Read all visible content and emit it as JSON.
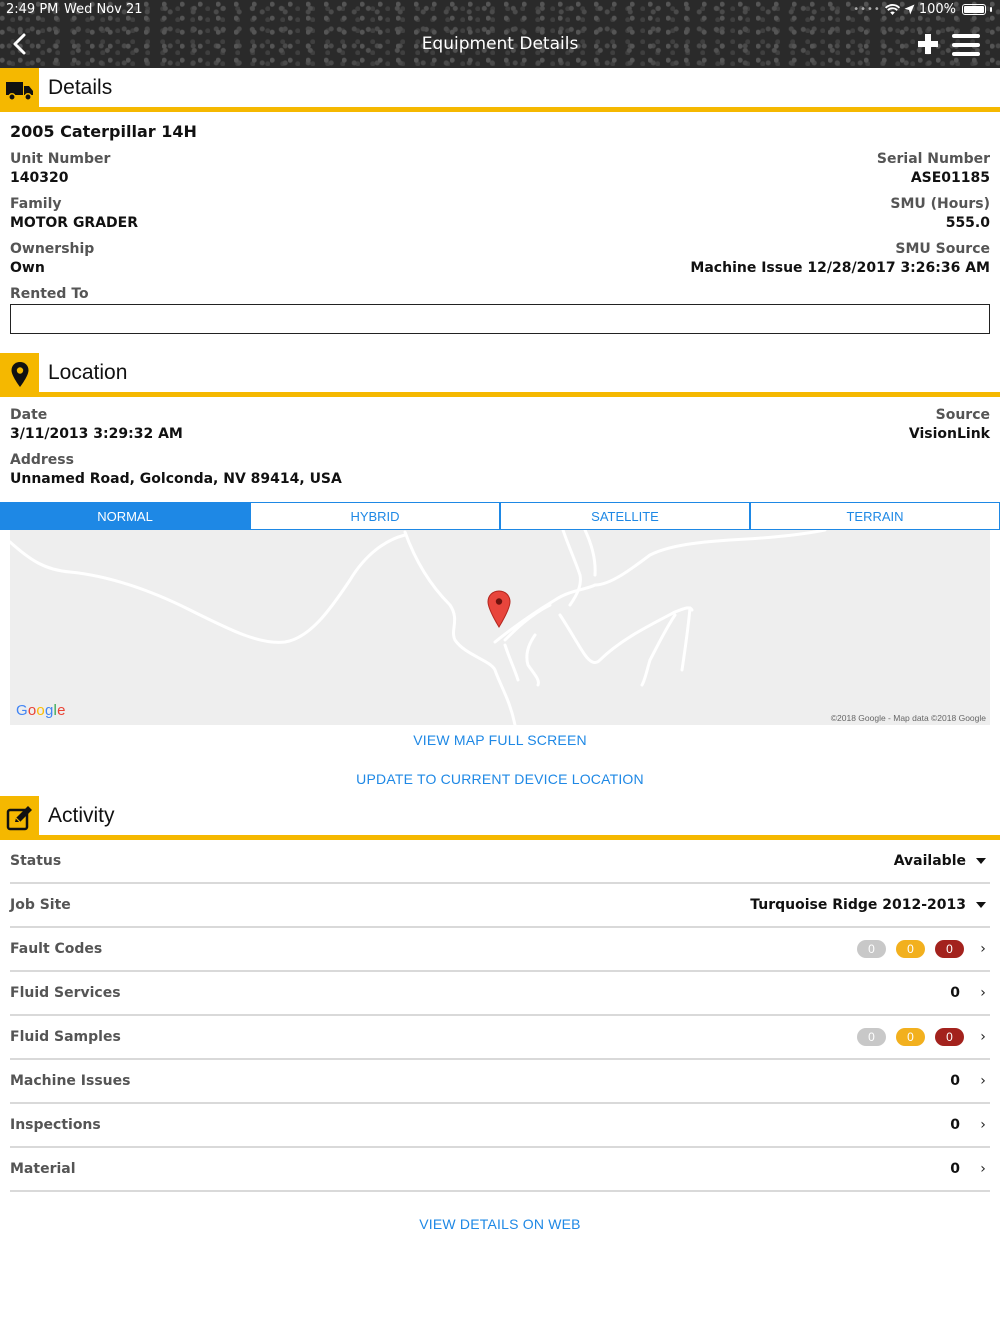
{
  "status_bar": {
    "time": "2:49 PM",
    "date": "Wed Nov 21",
    "battery": "100%"
  },
  "nav": {
    "title": "Equipment Details"
  },
  "details": {
    "section_title": "Details",
    "name": "2005 Caterpillar 14H",
    "unit_number_label": "Unit Number",
    "unit_number": "140320",
    "serial_number_label": "Serial Number",
    "serial_number": "ASE01185",
    "family_label": "Family",
    "family": "MOTOR GRADER",
    "smu_label": "SMU (Hours)",
    "smu": "555.0",
    "ownership_label": "Ownership",
    "ownership": "Own",
    "smu_source_label": "SMU Source",
    "smu_source": "Machine Issue 12/28/2017 3:26:36 AM",
    "rented_to_label": "Rented To",
    "rented_to_value": ""
  },
  "location": {
    "section_title": "Location",
    "date_label": "Date",
    "date": "3/11/2013 3:29:32 AM",
    "source_label": "Source",
    "source": "VisionLink",
    "address_label": "Address",
    "address": "Unnamed Road, Golconda, NV 89414, USA",
    "map_tabs": [
      "NORMAL",
      "HYBRID",
      "SATELLITE",
      "TERRAIN"
    ],
    "active_tab": "NORMAL",
    "google_logo": "Google",
    "map_attribution": "©2018 Google - Map data ©2018 Google",
    "view_full_screen": "VIEW MAP FULL SCREEN",
    "update_location": "UPDATE TO CURRENT DEVICE LOCATION"
  },
  "activity": {
    "section_title": "Activity",
    "rows": [
      {
        "label": "Status",
        "value": "Available",
        "kind": "dropdown"
      },
      {
        "label": "Job Site",
        "value": "Turquoise Ridge 2012-2013",
        "kind": "dropdown"
      },
      {
        "label": "Fault Codes",
        "counts": [
          "0",
          "0",
          "0"
        ],
        "kind": "pills"
      },
      {
        "label": "Fluid Services",
        "value": "0",
        "kind": "count"
      },
      {
        "label": "Fluid Samples",
        "counts": [
          "0",
          "0",
          "0"
        ],
        "kind": "pills"
      },
      {
        "label": "Machine Issues",
        "value": "0",
        "kind": "count"
      },
      {
        "label": "Inspections",
        "value": "0",
        "kind": "count"
      },
      {
        "label": "Material",
        "value": "0",
        "kind": "count"
      }
    ]
  },
  "footer": {
    "view_on_web": "VIEW DETAILS ON WEB"
  },
  "colors": {
    "accent": "#f5b800",
    "link": "#1e88e5",
    "pill_gray": "#c8c8c8",
    "pill_yellow": "#f2b01e",
    "pill_red": "#a3221d",
    "map_marker": "#e8453c"
  }
}
